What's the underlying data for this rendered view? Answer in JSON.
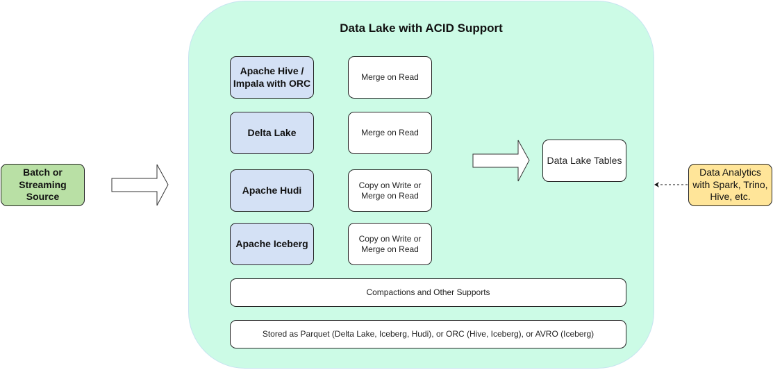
{
  "diagram": {
    "title": "Data Lake with ACID Support",
    "source": "Batch or Streaming Source",
    "formats": [
      {
        "name": "Apache Hive / Impala with ORC",
        "strategy": "Merge on Read"
      },
      {
        "name": "Delta Lake",
        "strategy": "Merge on Read"
      },
      {
        "name": "Apache Hudi",
        "strategy": "Copy on Write or Merge on Read"
      },
      {
        "name": "Apache Iceberg",
        "strategy": "Copy on Write or Merge on Read"
      }
    ],
    "compactions": "Compactions and Other Supports",
    "storage": "Stored as Parquet (Delta Lake, Iceberg, Hudi), or ORC (Hive, Iceberg), or AVRO (Iceberg)",
    "tables": "Data Lake Tables",
    "analytics": "Data Analytics with Spark, Trino, Hive, etc.",
    "colors": {
      "container": "#ccfbe6",
      "format_box": "#d4e1f5",
      "source_box": "#b9e0a5",
      "analytics_box": "#ffe599"
    }
  }
}
